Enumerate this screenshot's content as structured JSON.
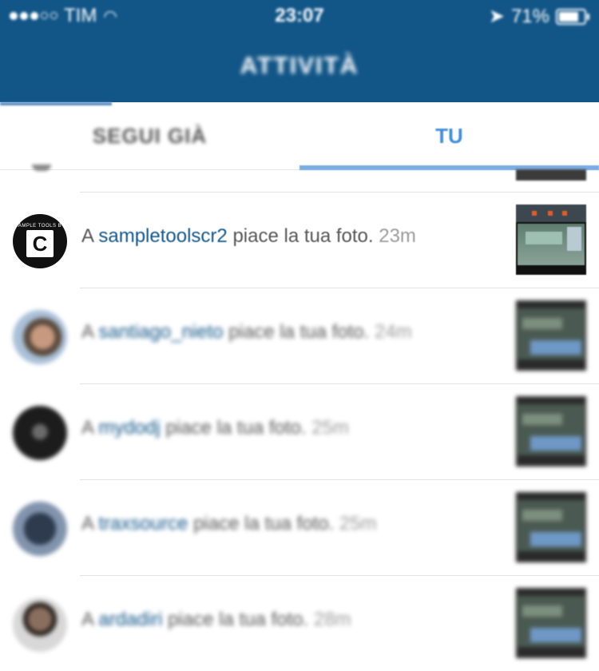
{
  "status_bar": {
    "carrier": "TIM",
    "time": "23:07",
    "battery": "71%"
  },
  "header": {
    "title": "ATTIVITÀ"
  },
  "tabs": [
    {
      "label": "SEGUI GIÀ",
      "selected": false
    },
    {
      "label": "TU",
      "selected": true
    }
  ],
  "colors": {
    "header_bg": "#125688",
    "accent": "#3f8ed8",
    "username": "#125688"
  },
  "avatar_sample": {
    "text": "SAMPLE TOOLS BY",
    "letter": "C"
  },
  "activities": [
    {
      "prefix": "A",
      "username": "sampletoolscr2",
      "action": "piace la tua foto.",
      "time": "23m"
    },
    {
      "prefix": "A",
      "username": "santiago_nieto",
      "action": "piace la tua foto.",
      "time": "24m"
    },
    {
      "prefix": "A",
      "username": "mydodj",
      "action": "piace la tua foto.",
      "time": "25m"
    },
    {
      "prefix": "A",
      "username": "traxsource",
      "action": "piace la tua foto.",
      "time": "25m"
    },
    {
      "prefix": "A",
      "username": "ardadiri",
      "action": "piace la tua foto.",
      "time": "28m"
    }
  ]
}
